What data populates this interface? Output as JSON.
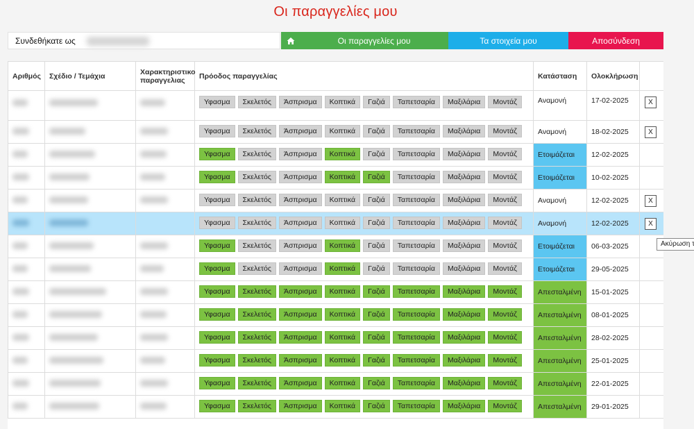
{
  "page_title": "Οι παραγγελίες μου",
  "login": {
    "label": "Συνδεθήκατε ως"
  },
  "nav": {
    "home_icon": "home-icon",
    "orders": "Οι παραγγελίες μου",
    "details": "Τα στοιχεία μου",
    "logout": "Αποσύνδεση",
    "colors": {
      "green": "#4cae4c",
      "blue": "#1daee9",
      "red": "#e8154e"
    }
  },
  "columns": {
    "order": "Αριθμός",
    "design": "Σχέδιο / Τεμάχια",
    "feature": "Χαρακτηριστικο παραγγελιας",
    "progress": "Πρόοδος παραγγελίας",
    "status": "Κατάσταση",
    "completion": "Ολοκλήρωση"
  },
  "stages": [
    "Υφασμα",
    "Σκελετός",
    "Άσπρισμα",
    "Κοπτικά",
    "Γαζιά",
    "Ταπετσαρία",
    "Μαξιλάρια",
    "Μοντάζ"
  ],
  "status_colors": {
    "ready": "#5bc6f1",
    "sent": "#7cc242",
    "done_stage": "#7cc242",
    "pending_stage": "#d2d2d2"
  },
  "cancel_label": "X",
  "tooltip": "Ακύρωση τ",
  "orders": [
    {
      "done": [
        0,
        0,
        0,
        0,
        0,
        0,
        0,
        0
      ],
      "status": "Αναμονή",
      "status_kind": "waiting",
      "date": "17-02-2025",
      "cancel": true
    },
    {
      "done": [
        0,
        0,
        0,
        0,
        0,
        0,
        0,
        0
      ],
      "status": "Αναμονή",
      "status_kind": "waiting",
      "date": "18-02-2025",
      "cancel": true
    },
    {
      "done": [
        1,
        0,
        0,
        1,
        0,
        0,
        0,
        0
      ],
      "status": "Ετοιμάζεται",
      "status_kind": "ready",
      "date": "12-02-2025",
      "cancel": false
    },
    {
      "done": [
        1,
        0,
        0,
        1,
        1,
        0,
        0,
        0
      ],
      "status": "Ετοιμάζεται",
      "status_kind": "ready",
      "date": "10-02-2025",
      "cancel": false
    },
    {
      "done": [
        0,
        0,
        0,
        0,
        0,
        0,
        0,
        0
      ],
      "status": "Αναμονή",
      "status_kind": "waiting",
      "date": "12-02-2025",
      "cancel": true
    },
    {
      "done": [
        0,
        0,
        0,
        0,
        0,
        0,
        0,
        0
      ],
      "status": "Αναμονή",
      "status_kind": "waiting",
      "date": "12-02-2025",
      "cancel": true,
      "highlight": true
    },
    {
      "done": [
        1,
        0,
        0,
        1,
        0,
        0,
        0,
        0
      ],
      "status": "Ετοιμάζεται",
      "status_kind": "ready",
      "date": "06-03-2025",
      "cancel": false
    },
    {
      "done": [
        1,
        0,
        0,
        1,
        0,
        0,
        0,
        0
      ],
      "status": "Ετοιμάζεται",
      "status_kind": "ready",
      "date": "29-05-2025",
      "cancel": false
    },
    {
      "done": [
        1,
        1,
        1,
        1,
        1,
        1,
        1,
        1
      ],
      "status": "Απεσταλμένη",
      "status_kind": "sent",
      "date": "15-01-2025",
      "cancel": false
    },
    {
      "done": [
        1,
        1,
        1,
        1,
        1,
        1,
        1,
        1
      ],
      "status": "Απεσταλμένη",
      "status_kind": "sent",
      "date": "08-01-2025",
      "cancel": false
    },
    {
      "done": [
        1,
        1,
        1,
        1,
        1,
        1,
        1,
        1
      ],
      "status": "Απεσταλμένη",
      "status_kind": "sent",
      "date": "28-02-2025",
      "cancel": false
    },
    {
      "done": [
        1,
        1,
        1,
        1,
        1,
        1,
        1,
        1
      ],
      "status": "Απεσταλμένη",
      "status_kind": "sent",
      "date": "25-01-2025",
      "cancel": false
    },
    {
      "done": [
        1,
        1,
        1,
        1,
        1,
        1,
        1,
        1
      ],
      "status": "Απεσταλμένη",
      "status_kind": "sent",
      "date": "22-01-2025",
      "cancel": false
    },
    {
      "done": [
        1,
        1,
        1,
        1,
        1,
        1,
        1,
        1
      ],
      "status": "Απεσταλμένη",
      "status_kind": "sent",
      "date": "29-01-2025",
      "cancel": false
    }
  ]
}
